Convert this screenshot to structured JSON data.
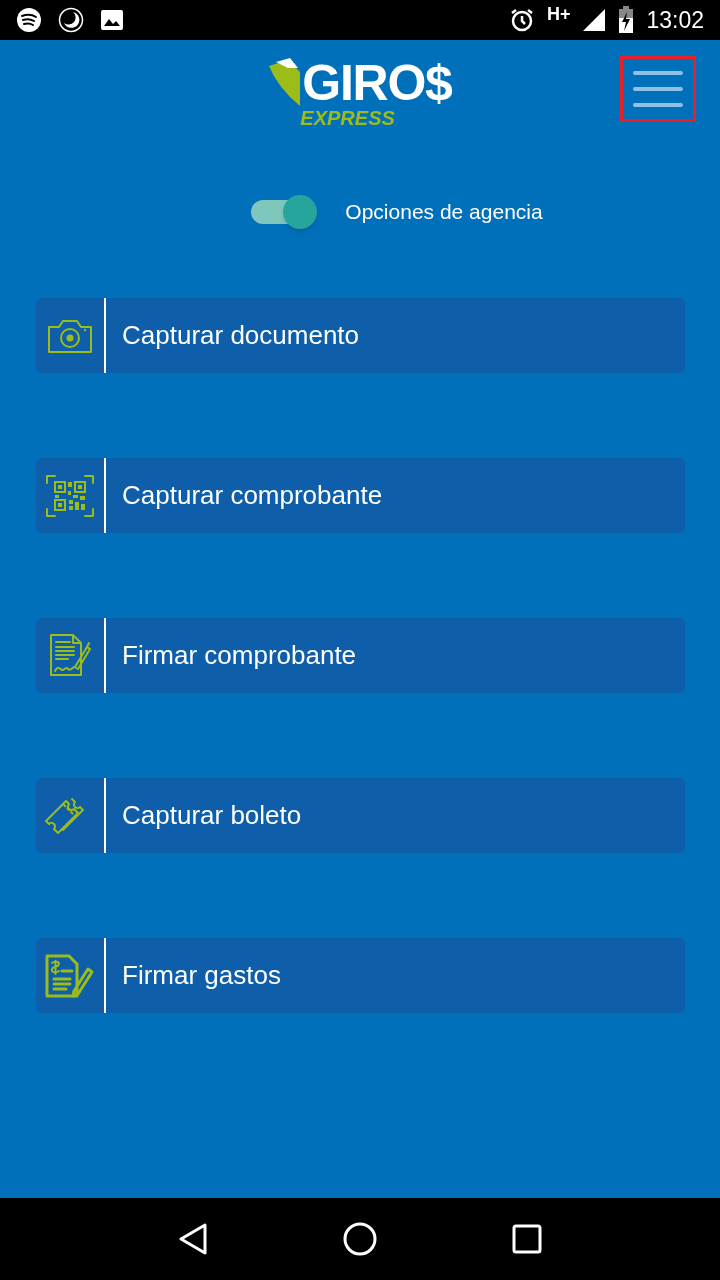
{
  "status_bar": {
    "network": "H+",
    "time": "13:02"
  },
  "header": {
    "logo": {
      "name": "GIRO$",
      "tagline": "EXPRESS"
    },
    "menu_button": {
      "highlighted": true
    }
  },
  "agency_toggle": {
    "label": "Opciones de agencia",
    "on": true
  },
  "actions": [
    {
      "label": "Capturar documento"
    },
    {
      "label": "Capturar comprobante"
    },
    {
      "label": "Firmar comprobante"
    },
    {
      "label": "Capturar boleto"
    },
    {
      "label": "Firmar gastos"
    }
  ]
}
